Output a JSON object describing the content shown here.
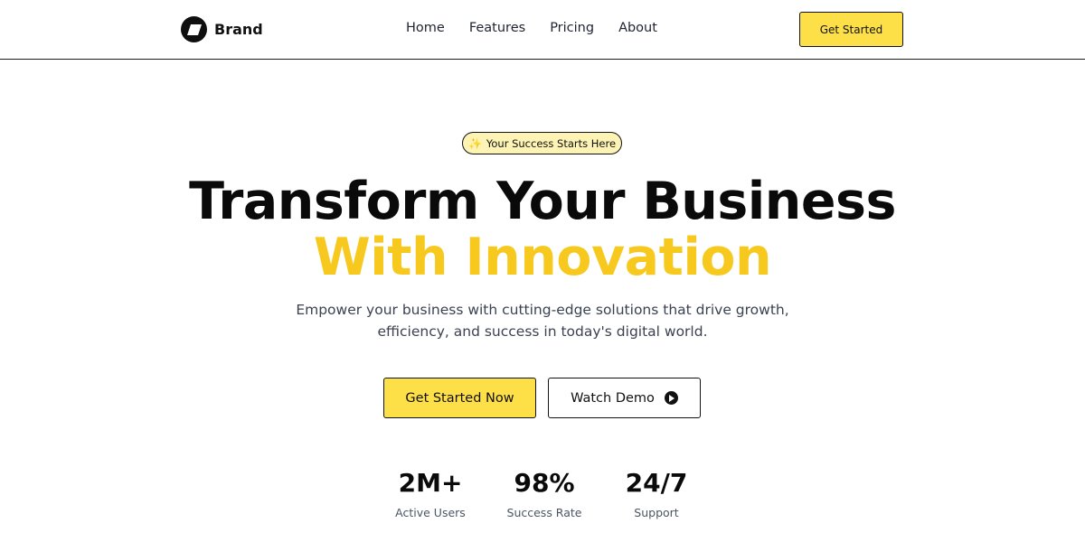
{
  "header": {
    "brand_name": "Brand",
    "nav": [
      {
        "label": "Home"
      },
      {
        "label": "Features"
      },
      {
        "label": "Pricing"
      },
      {
        "label": "About"
      }
    ],
    "cta_label": "Get Started"
  },
  "hero": {
    "badge_icon": "sparkles-icon",
    "badge_text": "Your Success Starts Here",
    "headline": "Transform Your Business",
    "headline_accent": "With Innovation",
    "subtitle": "Empower your business with cutting-edge solutions that drive growth, efficiency, and success in today's digital world.",
    "primary_button": "Get Started Now",
    "secondary_button": "Watch Demo",
    "secondary_icon": "play-circle-icon"
  },
  "stats": [
    {
      "value": "2M+",
      "label": "Active Users"
    },
    {
      "value": "98%",
      "label": "Success Rate"
    },
    {
      "value": "24/7",
      "label": "Support"
    }
  ],
  "colors": {
    "accent_yellow": "#fde047",
    "headline_yellow": "#f7c91e",
    "badge_background": "#fdf3b4",
    "text_dark": "#0a0a0a",
    "text_muted": "#4b5563"
  }
}
